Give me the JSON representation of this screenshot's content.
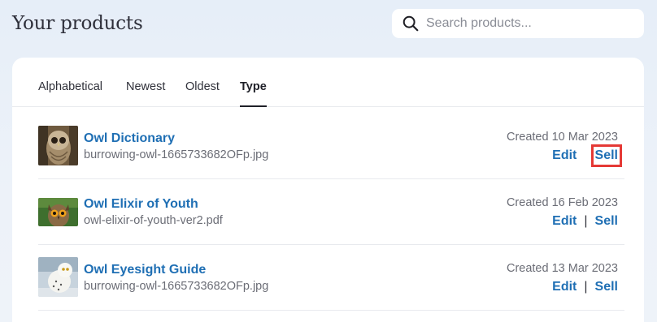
{
  "page": {
    "title": "Your products"
  },
  "search": {
    "placeholder": "Search products..."
  },
  "tabs": [
    {
      "label": "Alphabetical",
      "active": false
    },
    {
      "label": "Newest",
      "active": false
    },
    {
      "label": "Oldest",
      "active": false
    },
    {
      "label": "Type",
      "active": true
    }
  ],
  "products": [
    {
      "title": "Owl Dictionary",
      "file": "burrowing-owl-1665733682OFp.jpg",
      "created": "Created 10 Mar 2023",
      "edit": "Edit",
      "sell": "Sell",
      "separator": "|"
    },
    {
      "title": "Owl Elixir of Youth",
      "file": "owl-elixir-of-youth-ver2.pdf",
      "created": "Created 16 Feb 2023",
      "edit": "Edit",
      "sell": "Sell",
      "separator": "|"
    },
    {
      "title": "Owl Eyesight Guide",
      "file": "burrowing-owl-1665733682OFp.jpg",
      "created": "Created 13 Mar 2023",
      "edit": "Edit",
      "sell": "Sell",
      "separator": "|"
    }
  ],
  "colors": {
    "accent": "#1f6fb4",
    "highlight": "#e53935"
  }
}
